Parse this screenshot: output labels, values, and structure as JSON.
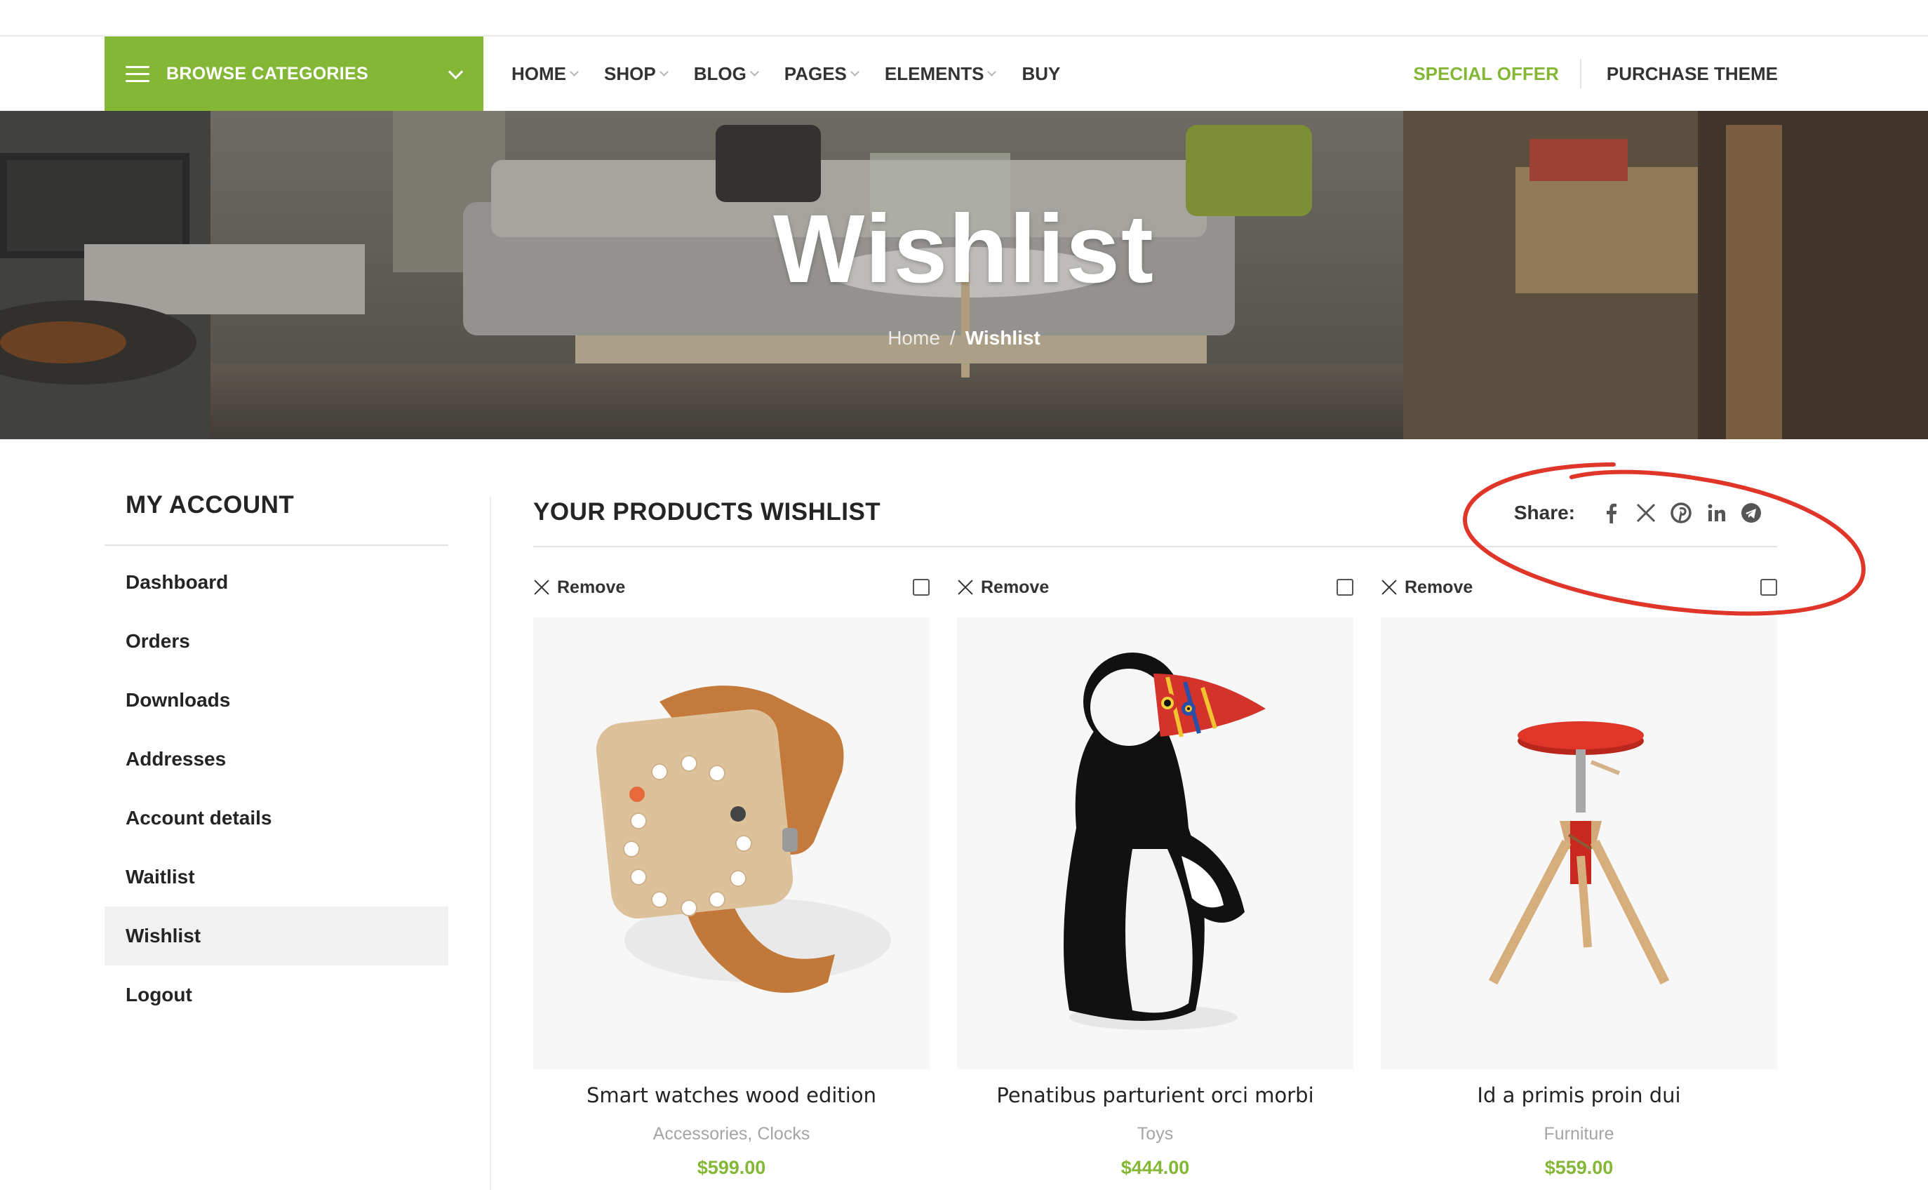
{
  "nav": {
    "browse_label": "BROWSE CATEGORIES",
    "items": [
      {
        "label": "HOME",
        "dropdown": true
      },
      {
        "label": "SHOP",
        "dropdown": true
      },
      {
        "label": "BLOG",
        "dropdown": true
      },
      {
        "label": "PAGES",
        "dropdown": true
      },
      {
        "label": "ELEMENTS",
        "dropdown": true
      },
      {
        "label": "BUY",
        "dropdown": false
      }
    ],
    "special_offer": "SPECIAL OFFER",
    "purchase_theme": "PURCHASE THEME"
  },
  "hero": {
    "title": "Wishlist",
    "breadcrumb_home": "Home",
    "breadcrumb_sep": "/",
    "breadcrumb_current": "Wishlist"
  },
  "sidebar": {
    "title": "MY ACCOUNT",
    "items": [
      "Dashboard",
      "Orders",
      "Downloads",
      "Addresses",
      "Account details",
      "Waitlist",
      "Wishlist",
      "Logout"
    ],
    "active": "Wishlist"
  },
  "wishlist": {
    "title": "YOUR PRODUCTS WISHLIST",
    "share_label": "Share:",
    "share_icons": [
      "facebook-icon",
      "x-twitter-icon",
      "pinterest-icon",
      "linkedin-icon",
      "telegram-icon"
    ],
    "remove_label": "Remove",
    "products": [
      {
        "name": "Smart watches wood edition",
        "categories": "Accessories, Clocks",
        "price": "$599.00",
        "image": "wooden-watch"
      },
      {
        "name": "Penatibus parturient orci morbi",
        "categories": "Toys",
        "price": "$444.00",
        "image": "puffin-figure"
      },
      {
        "name": "Id a primis proin dui",
        "categories": "Furniture",
        "price": "$559.00",
        "image": "red-stool"
      }
    ]
  },
  "colors": {
    "accent": "#83b735",
    "annotation": "#e0362a"
  }
}
